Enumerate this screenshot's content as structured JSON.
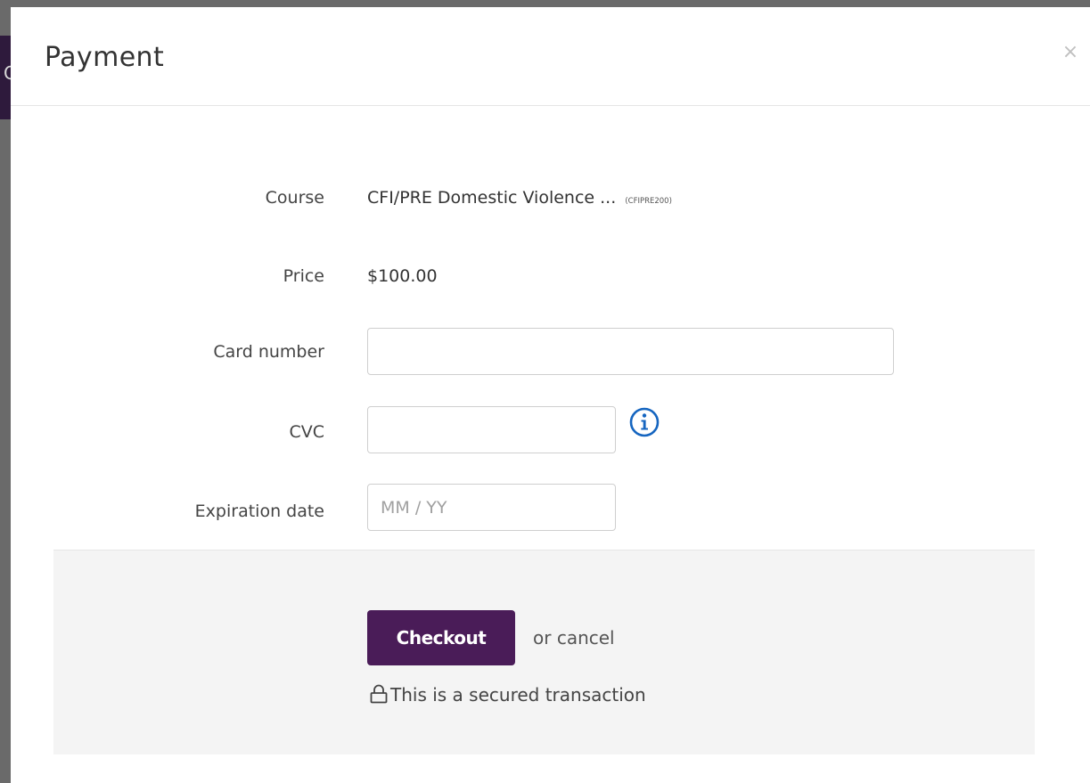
{
  "backdrop": {
    "letter": "C"
  },
  "modal": {
    "title": "Payment",
    "close_icon": "×"
  },
  "form": {
    "course_label": "Course",
    "course_value": "CFI/PRE Domestic Violence ...",
    "course_code": "(CFIPRE200)",
    "price_label": "Price",
    "price_value": "$100.00",
    "card_number_label": "Card number",
    "card_number_value": "",
    "cvc_label": "CVC",
    "cvc_value": "",
    "cvc_info_icon": "info-circle-icon",
    "expiration_label": "Expiration date",
    "expiration_placeholder": "MM / YY"
  },
  "footer": {
    "checkout_label": "Checkout",
    "or_text": "or",
    "cancel_label": "cancel",
    "secure_text": "This is a secured transaction",
    "lock_icon": "lock-icon"
  },
  "colors": {
    "accent": "#4a1c58",
    "info_icon": "#1565c0",
    "footer_bg": "#f4f4f4"
  }
}
